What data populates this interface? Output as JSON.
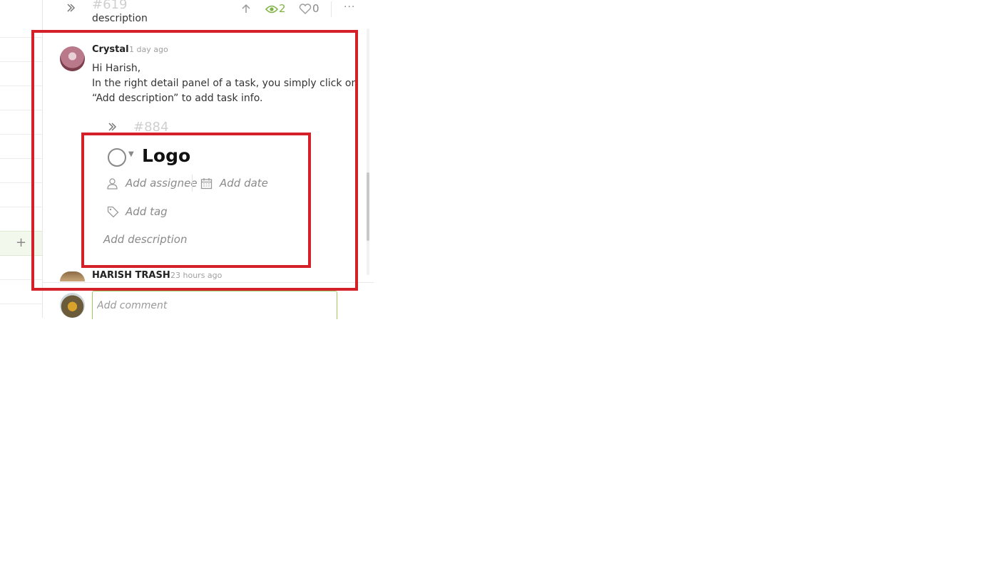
{
  "toolbar": {
    "task_number": "#619",
    "watchers_count": "2",
    "likes_count": "0",
    "more_label": "···"
  },
  "previous_comment_tail": "description",
  "comment": {
    "author": "Crystal",
    "time": "1 day ago",
    "lines": [
      "Hi Harish,",
      "In the right detail panel of a task, you simply click on",
      "“Add description” to add task info."
    ]
  },
  "task_card": {
    "number": "#884",
    "title": "Logo",
    "add_assignee": "Add assignee",
    "add_date": "Add date",
    "add_tag": "Add tag",
    "add_description": "Add description"
  },
  "next_comment": {
    "author": "HARISH TRASH",
    "time": "23 hours ago"
  },
  "composer": {
    "placeholder": "Add comment"
  },
  "colors": {
    "accent_green": "#7cb342",
    "annotation_red": "#d32029"
  },
  "icons": [
    "expand-chevron-icon",
    "upvote-arrow-icon",
    "eye-icon",
    "heart-icon",
    "more-icon",
    "check-circle-icon",
    "caret-down-icon",
    "user-icon",
    "calendar-icon",
    "tag-icon",
    "plus-icon"
  ]
}
